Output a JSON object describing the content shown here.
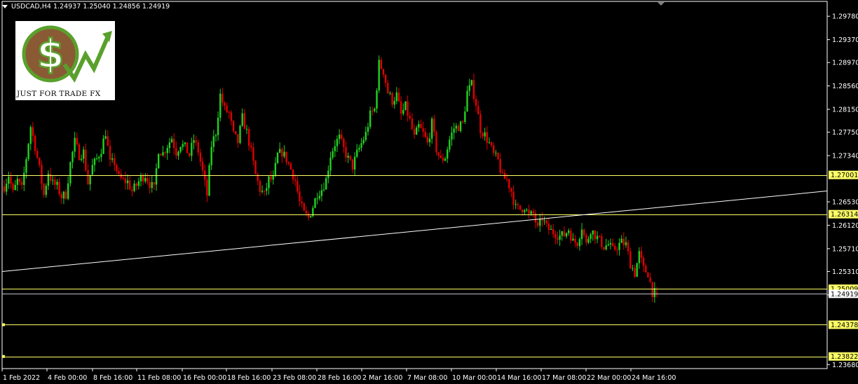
{
  "header": {
    "symbol_info": "USDCAD,H4",
    "ohlc": "1.24937 1.25040 1.24856 1.24919"
  },
  "logo": {
    "text": "JUST FOR TRADE FX"
  },
  "chart_data": {
    "type": "candlestick",
    "symbol": "USDCAD",
    "timeframe": "H4",
    "last_bar": {
      "open": 1.24937,
      "high": 1.2504,
      "low": 1.24856,
      "close": 1.24919
    },
    "y_ticks": [
      1.2978,
      1.2937,
      1.2897,
      1.2856,
      1.2815,
      1.2775,
      1.2734,
      1.2653,
      1.2612,
      1.2571,
      1.2531,
      1.249,
      1.2368
    ],
    "x_labels": [
      "1 Feb 2022",
      "4 Feb 00:00",
      "8 Feb 16:00",
      "11 Feb 08:00",
      "16 Feb 00:00",
      "18 Feb 16:00",
      "23 Feb 08:00",
      "28 Feb 16:00",
      "2 Mar 16:00",
      "7 Mar 08:00",
      "10 Mar 00:00",
      "14 Mar 16:00",
      "17 Mar 08:00",
      "22 Mar 00:00",
      "24 Mar 16:00"
    ],
    "horizontal_levels": [
      {
        "price": 1.27001,
        "label": "1.27001",
        "color": "#ffff66"
      },
      {
        "price": 1.26314,
        "label": "1.26314",
        "color": "#ffff66"
      },
      {
        "price": 1.25009,
        "label": "1.25009",
        "color": "#ffff66"
      },
      {
        "price": 1.24919,
        "label": "1.24919",
        "color": "#c0c0c0"
      },
      {
        "price": 1.24378,
        "label": "1.24378",
        "color": "#ffff66"
      },
      {
        "price": 1.23822,
        "label": "1.23822",
        "color": "#ffff66"
      }
    ],
    "trendline": {
      "from_price": 1.2531,
      "to_price": 1.2672,
      "color": "#ffffff"
    },
    "ylim": [
      1.2361,
      1.3004
    ],
    "path_prices": [
      1.268,
      1.27,
      1.2668,
      1.269,
      1.2675,
      1.273,
      1.2785,
      1.275,
      1.271,
      1.2665,
      1.2705,
      1.2685,
      1.268,
      1.2662,
      1.2666,
      1.272,
      1.2758,
      1.2735,
      1.274,
      1.2686,
      1.2715,
      1.2728,
      1.2745,
      1.2775,
      1.272,
      1.2722,
      1.2695,
      1.269,
      1.2688,
      1.2672,
      1.2682,
      1.2695,
      1.27,
      1.2685,
      1.2675,
      1.2745,
      1.2738,
      1.2752,
      1.2765,
      1.274,
      1.2755,
      1.2748,
      1.2735,
      1.2762,
      1.2742,
      1.2705,
      1.2665,
      1.2752,
      1.2775,
      1.284,
      1.2815,
      1.2808,
      1.277,
      1.2758,
      1.28,
      1.2775,
      1.274,
      1.27,
      1.2675,
      1.2665,
      1.2692,
      1.2692,
      1.2735,
      1.274,
      1.2728,
      1.271,
      1.269,
      1.2652,
      1.2632,
      1.2625,
      1.2645,
      1.2668,
      1.2675,
      1.2692,
      1.2735,
      1.2755,
      1.2765,
      1.2745,
      1.2728,
      1.2715,
      1.2738,
      1.2755,
      1.2772,
      1.2805,
      1.2815,
      1.2895,
      1.2882,
      1.2845,
      1.283,
      1.284,
      1.2805,
      1.282,
      1.2795,
      1.2765,
      1.2785,
      1.2772,
      1.2755,
      1.279,
      1.2745,
      1.2725,
      1.2732,
      1.2762,
      1.2782,
      1.2785,
      1.279,
      1.2845,
      1.2858,
      1.2825,
      1.278,
      1.277,
      1.2755,
      1.2735,
      1.2725,
      1.2695,
      1.2692,
      1.2672,
      1.2642,
      1.264,
      1.2645,
      1.2628,
      1.2632,
      1.2605,
      1.2625,
      1.2608,
      1.2602,
      1.2598,
      1.2593,
      1.2595,
      1.2605,
      1.2583,
      1.2582,
      1.261,
      1.2578,
      1.2605,
      1.2595,
      1.2585,
      1.2575,
      1.2578,
      1.2568,
      1.2575,
      1.2582,
      1.2578,
      1.2545,
      1.2528,
      1.2562,
      1.2535,
      1.2528,
      1.2495,
      1.2492
    ]
  }
}
